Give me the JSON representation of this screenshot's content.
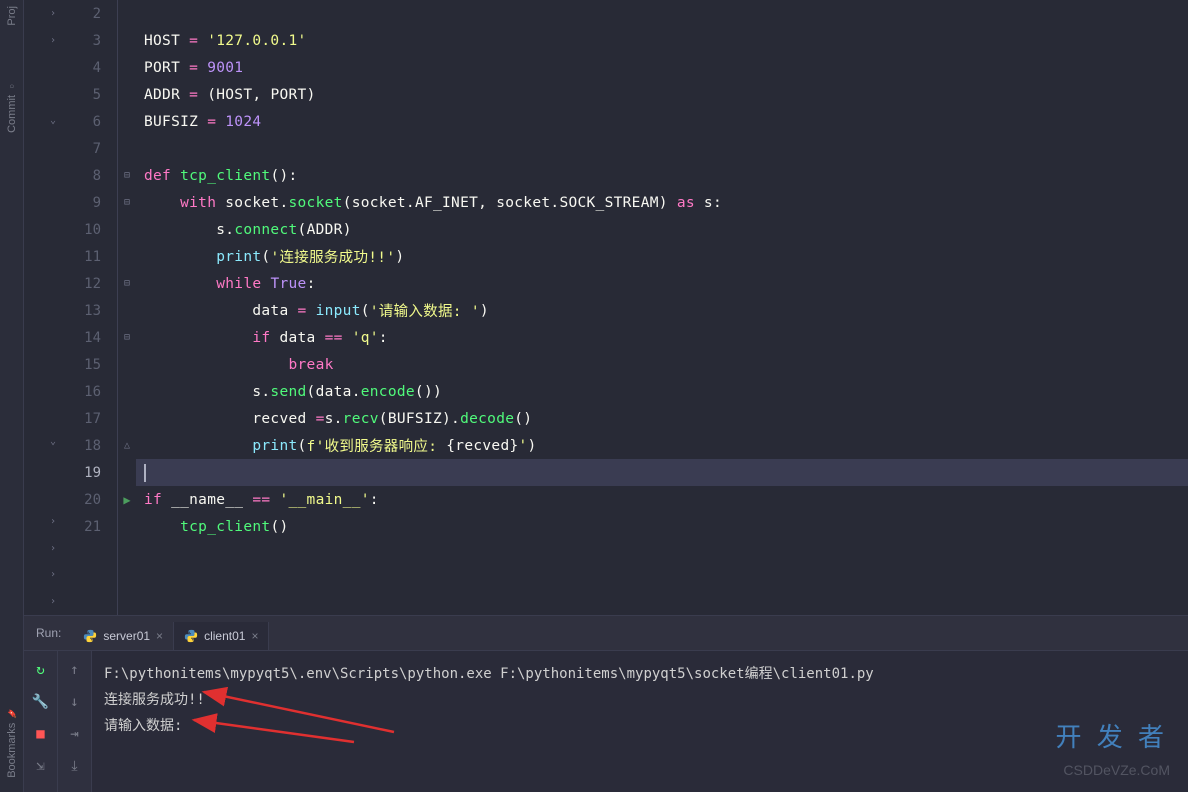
{
  "sidebar": {
    "labels": [
      "Proj",
      "Commit",
      "Bookmarks"
    ]
  },
  "editor": {
    "current_line": 19,
    "lines": [
      {
        "n": 2,
        "fold": "›",
        "content": []
      },
      {
        "n": 3,
        "fold": "›",
        "tokens": [
          {
            "t": "HOST ",
            "c": "c-var"
          },
          {
            "t": "= ",
            "c": "c-op"
          },
          {
            "t": "'127.0.0.1'",
            "c": "c-str"
          }
        ]
      },
      {
        "n": 4,
        "fold": "",
        "tokens": [
          {
            "t": "PORT ",
            "c": "c-var"
          },
          {
            "t": "= ",
            "c": "c-op"
          },
          {
            "t": "9001",
            "c": "c-num"
          }
        ]
      },
      {
        "n": 5,
        "fold": "",
        "tokens": [
          {
            "t": "ADDR ",
            "c": "c-var"
          },
          {
            "t": "= ",
            "c": "c-op"
          },
          {
            "t": "(",
            "c": "c-par"
          },
          {
            "t": "HOST",
            "c": "c-var"
          },
          {
            "t": ", ",
            "c": "c-par"
          },
          {
            "t": "PORT",
            "c": "c-var"
          },
          {
            "t": ")",
            "c": "c-par"
          }
        ]
      },
      {
        "n": 6,
        "fold": "⌄",
        "tokens": [
          {
            "t": "BUFSIZ ",
            "c": "c-var"
          },
          {
            "t": "= ",
            "c": "c-op"
          },
          {
            "t": "1024",
            "c": "c-num"
          }
        ]
      },
      {
        "n": 7,
        "fold": "",
        "tokens": []
      },
      {
        "n": 8,
        "fold": "",
        "fm": "⊟",
        "tokens": [
          {
            "t": "def ",
            "c": "c-kw"
          },
          {
            "t": "tcp_client",
            "c": "c-fn"
          },
          {
            "t": "():",
            "c": "c-par"
          }
        ]
      },
      {
        "n": 9,
        "fold": "",
        "fm": "⊟",
        "tokens": [
          {
            "t": "    ",
            "c": ""
          },
          {
            "t": "with ",
            "c": "c-kw"
          },
          {
            "t": "socket",
            "c": "c-var"
          },
          {
            "t": ".",
            "c": "c-par"
          },
          {
            "t": "socket",
            "c": "c-call"
          },
          {
            "t": "(",
            "c": "c-par"
          },
          {
            "t": "socket",
            "c": "c-var"
          },
          {
            "t": ".",
            "c": "c-par"
          },
          {
            "t": "AF_INET",
            "c": "c-var"
          },
          {
            "t": ", ",
            "c": "c-par"
          },
          {
            "t": "socket",
            "c": "c-var"
          },
          {
            "t": ".",
            "c": "c-par"
          },
          {
            "t": "SOCK_STREAM",
            "c": "c-var"
          },
          {
            "t": ") ",
            "c": "c-par"
          },
          {
            "t": "as ",
            "c": "c-kw"
          },
          {
            "t": "s",
            "c": "c-var"
          },
          {
            "t": ":",
            "c": "c-par"
          }
        ]
      },
      {
        "n": 10,
        "fold": "",
        "tokens": [
          {
            "t": "        ",
            "c": ""
          },
          {
            "t": "s",
            "c": "c-var"
          },
          {
            "t": ".",
            "c": "c-par"
          },
          {
            "t": "connect",
            "c": "c-call"
          },
          {
            "t": "(",
            "c": "c-par"
          },
          {
            "t": "ADDR",
            "c": "c-var"
          },
          {
            "t": ")",
            "c": "c-par"
          }
        ]
      },
      {
        "n": 11,
        "fold": "",
        "tokens": [
          {
            "t": "        ",
            "c": ""
          },
          {
            "t": "print",
            "c": "c-builtin"
          },
          {
            "t": "(",
            "c": "c-par"
          },
          {
            "t": "'连接服务成功!!'",
            "c": "c-str"
          },
          {
            "t": ")",
            "c": "c-par"
          }
        ]
      },
      {
        "n": 12,
        "fold": "",
        "fm": "⊟",
        "tokens": [
          {
            "t": "        ",
            "c": ""
          },
          {
            "t": "while ",
            "c": "c-kw"
          },
          {
            "t": "True",
            "c": "c-bool"
          },
          {
            "t": ":",
            "c": "c-par"
          }
        ]
      },
      {
        "n": 13,
        "fold": "",
        "tokens": [
          {
            "t": "            ",
            "c": ""
          },
          {
            "t": "data ",
            "c": "c-var"
          },
          {
            "t": "= ",
            "c": "c-op"
          },
          {
            "t": "input",
            "c": "c-builtin"
          },
          {
            "t": "(",
            "c": "c-par"
          },
          {
            "t": "'请输入数据: '",
            "c": "c-str"
          },
          {
            "t": ")",
            "c": "c-par"
          }
        ]
      },
      {
        "n": 14,
        "fold": "",
        "fm": "⊟",
        "tokens": [
          {
            "t": "            ",
            "c": ""
          },
          {
            "t": "if ",
            "c": "c-kw"
          },
          {
            "t": "data ",
            "c": "c-var"
          },
          {
            "t": "== ",
            "c": "c-op"
          },
          {
            "t": "'q'",
            "c": "c-str"
          },
          {
            "t": ":",
            "c": "c-par"
          }
        ]
      },
      {
        "n": 15,
        "fold": "",
        "tokens": [
          {
            "t": "                ",
            "c": ""
          },
          {
            "t": "break",
            "c": "c-kw"
          }
        ]
      },
      {
        "n": 16,
        "fold": "",
        "tokens": [
          {
            "t": "            ",
            "c": ""
          },
          {
            "t": "s",
            "c": "c-var"
          },
          {
            "t": ".",
            "c": "c-par"
          },
          {
            "t": "send",
            "c": "c-call"
          },
          {
            "t": "(",
            "c": "c-par"
          },
          {
            "t": "data",
            "c": "c-var"
          },
          {
            "t": ".",
            "c": "c-par"
          },
          {
            "t": "encode",
            "c": "c-call"
          },
          {
            "t": "())",
            "c": "c-par"
          }
        ]
      },
      {
        "n": 17,
        "fold": "",
        "tokens": [
          {
            "t": "            ",
            "c": ""
          },
          {
            "t": "recved ",
            "c": "c-var"
          },
          {
            "t": "=",
            "c": "c-op"
          },
          {
            "t": "s",
            "c": "c-var"
          },
          {
            "t": ".",
            "c": "c-par"
          },
          {
            "t": "recv",
            "c": "c-call"
          },
          {
            "t": "(",
            "c": "c-par"
          },
          {
            "t": "BUFSIZ",
            "c": "c-var"
          },
          {
            "t": ").",
            "c": "c-par"
          },
          {
            "t": "decode",
            "c": "c-call"
          },
          {
            "t": "()",
            "c": "c-par"
          }
        ]
      },
      {
        "n": 18,
        "fold": "⌄",
        "fm": "△",
        "tokens": [
          {
            "t": "            ",
            "c": ""
          },
          {
            "t": "print",
            "c": "c-builtin"
          },
          {
            "t": "(",
            "c": "c-par"
          },
          {
            "t": "f'收到服务器响应: ",
            "c": "c-str"
          },
          {
            "t": "{",
            "c": "c-par"
          },
          {
            "t": "recved",
            "c": "c-var"
          },
          {
            "t": "}",
            "c": "c-par"
          },
          {
            "t": "'",
            "c": "c-str"
          },
          {
            "t": ")",
            "c": "c-par"
          }
        ]
      },
      {
        "n": 19,
        "fold": "",
        "highlighted": true,
        "tokens": []
      },
      {
        "n": 20,
        "fold": "",
        "run": true,
        "fm": "⊟",
        "tokens": [
          {
            "t": "if ",
            "c": "c-kw"
          },
          {
            "t": "__name__ ",
            "c": "c-var"
          },
          {
            "t": "== ",
            "c": "c-op"
          },
          {
            "t": "'__main__'",
            "c": "c-str"
          },
          {
            "t": ":",
            "c": "c-par"
          }
        ]
      },
      {
        "n": 21,
        "fold": "›",
        "tokens": [
          {
            "t": "    ",
            "c": ""
          },
          {
            "t": "tcp_client",
            "c": "c-call"
          },
          {
            "t": "()",
            "c": "c-par"
          }
        ]
      }
    ],
    "extra_folds": [
      "›",
      "›",
      "›"
    ]
  },
  "run": {
    "label": "Run:",
    "tabs": [
      {
        "name": "server01",
        "active": false
      },
      {
        "name": "client01",
        "active": true
      }
    ],
    "console": [
      "F:\\pythonitems\\mypyqt5\\.env\\Scripts\\python.exe F:\\pythonitems\\mypyqt5\\socket编程\\client01.py",
      "连接服务成功!!",
      "请输入数据: "
    ],
    "tool_icons1": [
      "rerun",
      "wrench",
      "stop",
      "layout"
    ],
    "tool_icons2": [
      "up",
      "down",
      "wrap",
      "scroll"
    ]
  },
  "watermark": {
    "cn": "开 发 者",
    "en": "CSDDeVZe.CoM"
  }
}
